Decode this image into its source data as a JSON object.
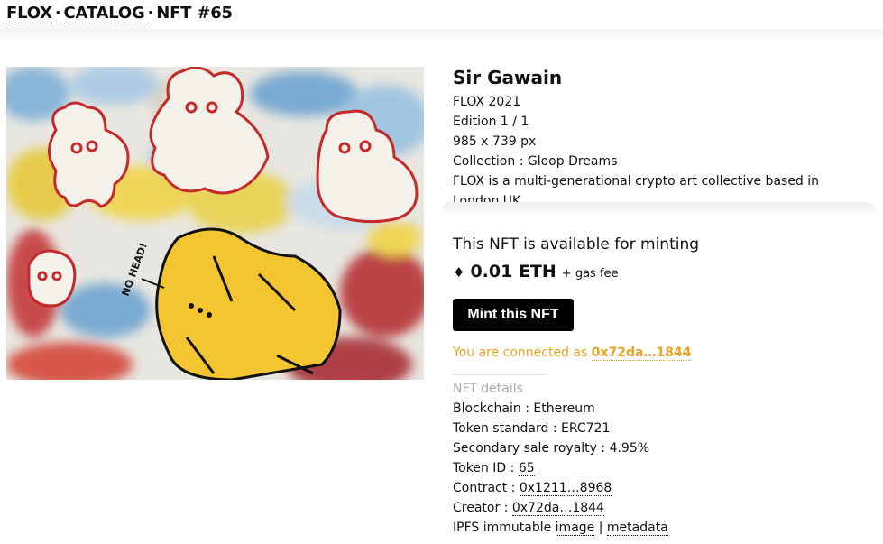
{
  "breadcrumb": {
    "home": "FLOX",
    "catalog": "CATALOG",
    "current": "NFT #65",
    "sep": "·"
  },
  "artwork": {
    "alt": "Sir Gawain artwork",
    "annotation": "NO HEAD!"
  },
  "info": {
    "title": "Sir Gawain",
    "artist_year": "FLOX 2021",
    "edition": "Edition 1 / 1",
    "dimensions": "985 x 739 px",
    "collection": "Collection : Gloop Dreams",
    "description": "FLOX is a multi-generational crypto art collective based in London UK"
  },
  "mint": {
    "availability": "This NFT is available for minting",
    "eth_icon": "♦",
    "price": "0.01 ETH",
    "gas": "+ gas fee",
    "button": "Mint this NFT",
    "connected_prefix": "You are connected as",
    "connected_address": "0x72da…1844"
  },
  "details": {
    "header": "NFT details",
    "blockchain": "Blockchain : Ethereum",
    "token_standard": "Token standard : ERC721",
    "royalty": "Secondary sale royalty : 4.95%",
    "token_id_label": "Token ID :",
    "token_id": "65",
    "contract_label": "Contract :",
    "contract": "0x1211…8968",
    "creator_label": "Creator :",
    "creator": "0x72da…1844",
    "ipfs_label": "IPFS immutable",
    "image_link": "image",
    "ipfs_sep": "|",
    "metadata_link": "metadata"
  },
  "colors": {
    "accent": "#e8a321",
    "text": "#111111",
    "button_bg": "#000000"
  }
}
